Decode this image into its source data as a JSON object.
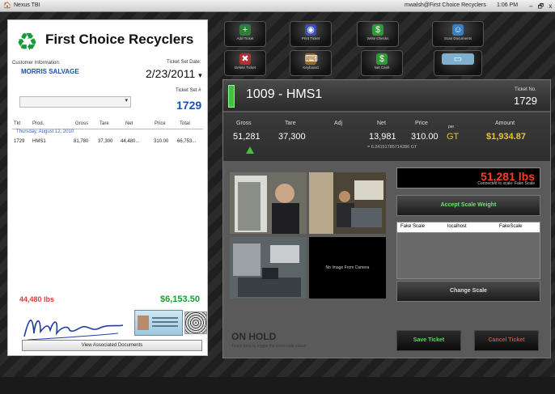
{
  "titlebar": {
    "app": "Nexus TBI",
    "user": "mwalsh@First Choice Recyclers",
    "time": "1:06 PM",
    "controls": "– 🗗 x"
  },
  "ticket": {
    "company": "First Choice Recyclers",
    "customer_label": "Customer Information:",
    "customer_name": "MORRIS SALVAGE",
    "date_label": "Ticket Set Date:",
    "date": "2/23/2011",
    "date_arrow": "▾",
    "set_label": "Ticket Set #",
    "set_number": "1729",
    "dropdown_arrow": "▾",
    "columns": [
      "Tkt",
      "Prod.",
      "Gross",
      "Tare",
      "Net",
      "Price",
      "Total"
    ],
    "group": "Thursday, August 12, 2010",
    "rows": [
      [
        "1729",
        "HMS1",
        "81,780",
        "37,300",
        "44,480...",
        "310.00",
        "66,753..."
      ]
    ],
    "total_weight": "44,480 lbs",
    "total_amount": "$6,153.50",
    "view_docs": "View Associated Documents"
  },
  "toolbar": [
    {
      "label": "Add Ticket",
      "icon": "+",
      "color": "#2f7d3a"
    },
    {
      "label": "Print Ticket",
      "icon": "◉",
      "color": "#3b4fb8"
    },
    {
      "label": "Write Checks",
      "icon": "$",
      "color": "#2f9a3a"
    },
    {
      "label": "Scan Documents",
      "icon": "☺",
      "color": "#3a7fc0"
    },
    {
      "label": "Delete Ticket",
      "icon": "✖",
      "color": "#b03030"
    },
    {
      "label": "Keyboard",
      "icon": "⌨",
      "color": "#9a6a2a"
    },
    {
      "label": "Net Cash",
      "icon": "$",
      "color": "#2f9a3a"
    },
    {
      "label": "",
      "icon": "▭",
      "color": "#7fb0d0"
    }
  ],
  "detail": {
    "title": "1009 - HMS1",
    "ticket_no_label": "Ticket No.",
    "ticket_no": "1729",
    "gross_label": "Gross",
    "gross": "51,281",
    "tare_label": "Tare",
    "tare": "37,300",
    "adj_label": "Adj",
    "net_label": "Net",
    "net": "13,981",
    "price_label": "Price",
    "price": "310.00",
    "per": "per",
    "unit": "GT",
    "amount_label": "Amount",
    "amount": "$1,934.87",
    "net_gt": "= 6.24151785714286 GT",
    "no_image": "No Image From Camera",
    "on_hold": "ON HOLD",
    "on_hold_sub": "Touch here to toggle the ticket hold status"
  },
  "scale": {
    "weight": "51,281 lbs",
    "connected": "Connected to scale: Fake Scale",
    "accept": "Accept Scale Weight",
    "table": [
      "Fake Scale",
      "localhost",
      "FakeScale"
    ],
    "change": "Change Scale"
  },
  "actions": {
    "save": "Save Ticket",
    "cancel": "Cancel Ticket"
  },
  "colors": {
    "accent_green": "#3fc23f",
    "amount_gold": "#e2c63f",
    "weight_red": "#ff3a2a",
    "cancel_red": "#e04040",
    "link_blue": "#1a4fb5"
  }
}
